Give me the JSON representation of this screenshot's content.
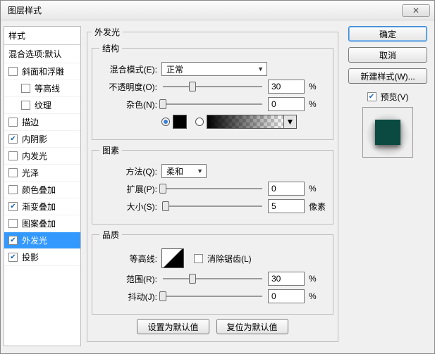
{
  "window": {
    "title": "图层样式"
  },
  "sidebar": {
    "header": "样式",
    "blend_defaults": "混合选项:默认",
    "items": [
      {
        "label": "斜面和浮雕",
        "checked": false
      },
      {
        "label": "等高线",
        "checked": false,
        "sub": true
      },
      {
        "label": "纹理",
        "checked": false,
        "sub": true
      },
      {
        "label": "描边",
        "checked": false
      },
      {
        "label": "内阴影",
        "checked": true
      },
      {
        "label": "内发光",
        "checked": false
      },
      {
        "label": "光泽",
        "checked": false
      },
      {
        "label": "颜色叠加",
        "checked": false
      },
      {
        "label": "渐变叠加",
        "checked": true
      },
      {
        "label": "图案叠加",
        "checked": false
      },
      {
        "label": "外发光",
        "checked": true,
        "selected": true
      },
      {
        "label": "投影",
        "checked": true
      }
    ]
  },
  "panel": {
    "title": "外发光",
    "structure": {
      "legend": "结构",
      "blend_mode_label": "混合模式(E):",
      "blend_mode_value": "正常",
      "opacity_label": "不透明度(O):",
      "opacity_value": "30",
      "opacity_unit": "%",
      "noise_label": "杂色(N):",
      "noise_value": "0",
      "noise_unit": "%"
    },
    "elements": {
      "legend": "图素",
      "method_label": "方法(Q):",
      "method_value": "柔和",
      "spread_label": "扩展(P):",
      "spread_value": "0",
      "spread_unit": "%",
      "size_label": "大小(S):",
      "size_value": "5",
      "size_unit": "像素"
    },
    "quality": {
      "legend": "品质",
      "contour_label": "等高线:",
      "antialias_label": "消除锯齿(L)",
      "range_label": "范围(R):",
      "range_value": "30",
      "range_unit": "%",
      "jitter_label": "抖动(J):",
      "jitter_value": "0",
      "jitter_unit": "%"
    },
    "buttons": {
      "set_default": "设置为默认值",
      "reset_default": "复位为默认值"
    }
  },
  "right": {
    "ok": "确定",
    "cancel": "取消",
    "new_style": "新建样式(W)...",
    "preview_label": "预览(V)"
  }
}
